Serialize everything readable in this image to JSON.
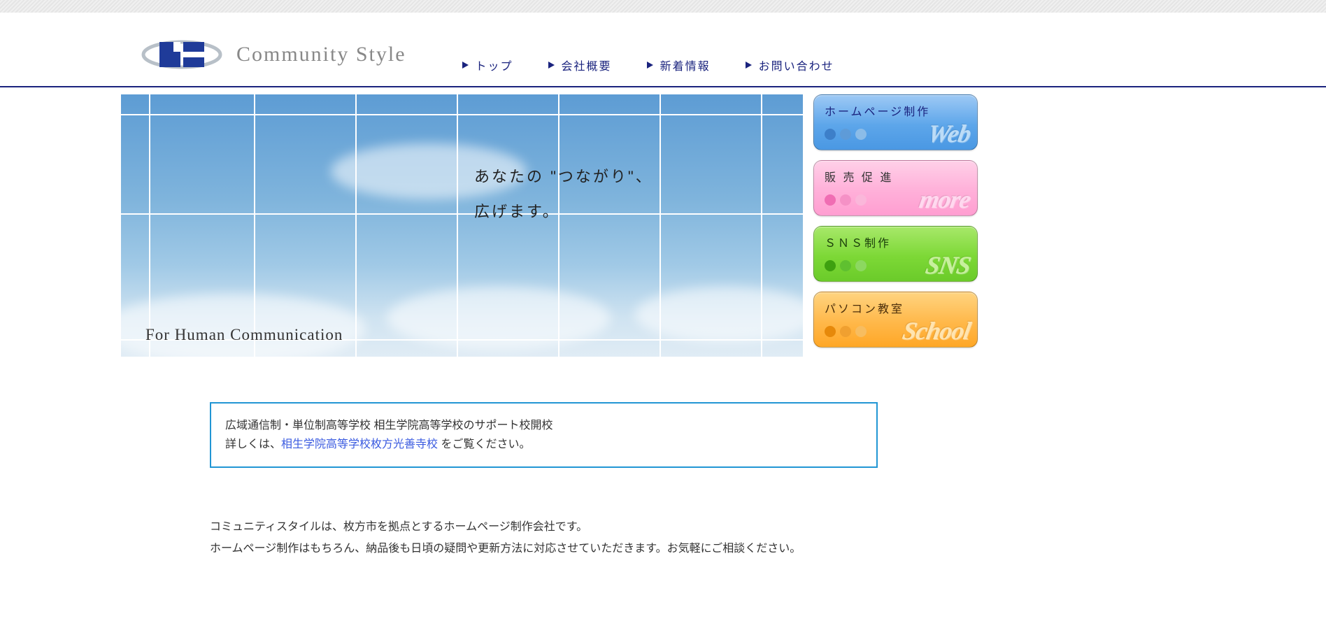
{
  "header": {
    "logo_text": "Community Style",
    "nav": [
      {
        "label": "トップ"
      },
      {
        "label": "会社概要"
      },
      {
        "label": "新着情報"
      },
      {
        "label": "お問い合わせ"
      }
    ]
  },
  "hero": {
    "line1": "あなたの \"つながり\"、",
    "line2": "広げます。",
    "tag": "For Human Communication"
  },
  "side_buttons": [
    {
      "label": "ホームページ制作",
      "big": "Web",
      "cls": "btn-web"
    },
    {
      "label": "販 売 促 進",
      "big": "more",
      "cls": "btn-more"
    },
    {
      "label": "ＳＮＳ制作",
      "big": "SNS",
      "cls": "btn-sns"
    },
    {
      "label": "パソコン教室",
      "big": "School",
      "cls": "btn-school"
    }
  ],
  "info": {
    "line1": "広域通信制・単位制高等学校 相生学院高等学校のサポート校開校",
    "line2_prefix": "詳しくは、",
    "link": "相生学院高等学校枚方光善寺校",
    "line2_suffix": " をご覧ください。"
  },
  "body": {
    "p1": "コミュニティスタイルは、枚方市を拠点とするホームページ制作会社です。",
    "p2": "ホームページ制作はもちろん、納品後も日頃の疑問や更新方法に対応させていただきます。お気軽にご相談ください。"
  }
}
